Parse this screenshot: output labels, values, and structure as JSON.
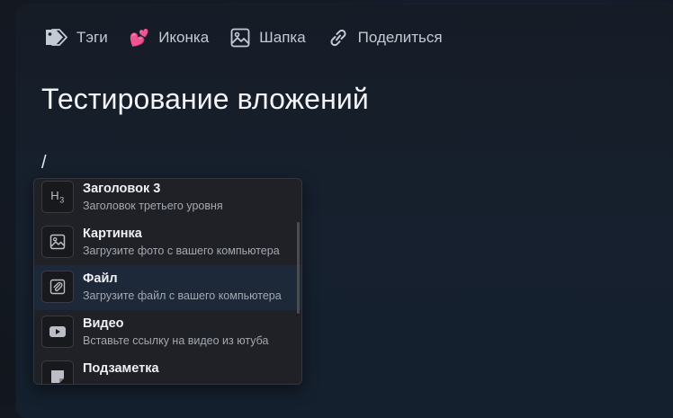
{
  "toolbar": {
    "tags_label": "Тэги",
    "icon_label": "Иконка",
    "icon_emoji": "💕",
    "cover_label": "Шапка",
    "share_label": "Поделиться"
  },
  "document": {
    "title": "Тестирование вложений",
    "input_text": "/"
  },
  "menu": {
    "items": [
      {
        "icon": "heading-3-icon",
        "icon_text": "H3",
        "title": "Заголовок 3",
        "description": "Заголовок третьего уровня",
        "active": false
      },
      {
        "icon": "image-icon",
        "title": "Картинка",
        "description": "Загрузите фото с вашего компьютера",
        "active": false
      },
      {
        "icon": "paperclip-icon",
        "title": "Файл",
        "description": "Загрузите файл с вашего компьютера",
        "active": true
      },
      {
        "icon": "play-icon",
        "title": "Видео",
        "description": "Вставьте ссылку на видео из ютуба",
        "active": false
      },
      {
        "icon": "note-icon",
        "title": "Подзаметка",
        "description": "",
        "active": false
      }
    ]
  },
  "colors": {
    "background": "#141820",
    "menu_background": "#202126",
    "active_item": "#1d2838"
  }
}
